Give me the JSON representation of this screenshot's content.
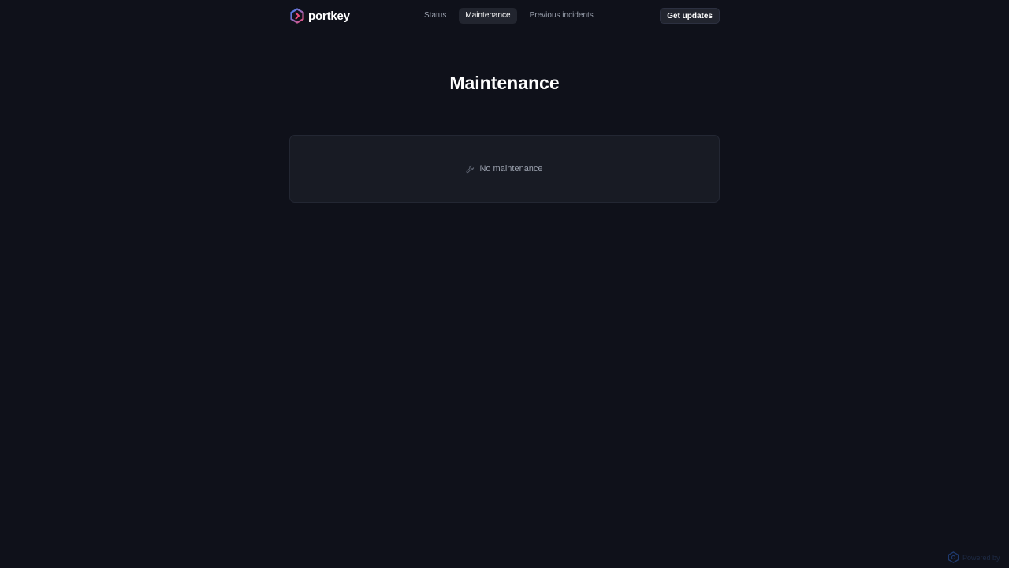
{
  "header": {
    "brand_name": "portkey",
    "nav": [
      {
        "label": "Status",
        "active": false
      },
      {
        "label": "Maintenance",
        "active": true
      },
      {
        "label": "Previous incidents",
        "active": false
      }
    ],
    "updates_button_label": "Get updates"
  },
  "main": {
    "title": "Maintenance",
    "empty_state": {
      "icon": "wrench-icon",
      "text": "No maintenance"
    }
  },
  "footer_badge": {
    "icon": "hexagon-logo-icon",
    "text": "Powered by"
  },
  "colors": {
    "background": "#0f111a",
    "card": "#181b24",
    "active_tab": "#22252f",
    "logo_blue": "#3b82f6",
    "logo_pink": "#ef4e7a"
  }
}
